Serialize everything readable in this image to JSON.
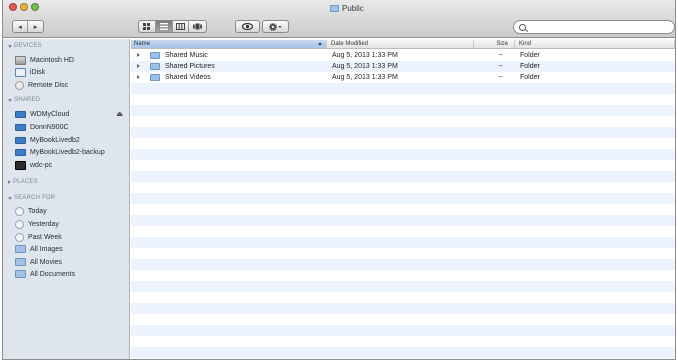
{
  "window": {
    "title": "Public"
  },
  "toolbar": {
    "back_label": "◂",
    "forward_label": "▸",
    "search_placeholder": ""
  },
  "sidebar": {
    "sections": [
      {
        "label": "DEVICES"
      },
      {
        "label": "SHARED"
      },
      {
        "label": "PLACES"
      },
      {
        "label": "SEARCH FOR"
      }
    ],
    "devices": [
      {
        "label": "Macintosh HD",
        "icon": "hard-drive-icon"
      },
      {
        "label": "iDisk",
        "icon": "idisk-icon"
      },
      {
        "label": "Remote Disc",
        "icon": "disc-icon"
      }
    ],
    "shared": [
      {
        "label": "WDMyCloud",
        "icon": "network-drive-icon"
      },
      {
        "label": "DonnN900C",
        "icon": "network-drive-icon"
      },
      {
        "label": "MyBookLivedb2",
        "icon": "network-drive-icon"
      },
      {
        "label": "MyBookLivedb2-backup",
        "icon": "network-drive-icon"
      },
      {
        "label": "wdc-pc",
        "icon": "pc-icon"
      }
    ],
    "search_for": [
      {
        "label": "Today",
        "icon": "clock-icon"
      },
      {
        "label": "Yesterday",
        "icon": "clock-icon"
      },
      {
        "label": "Past Week",
        "icon": "clock-icon"
      },
      {
        "label": "All Images",
        "icon": "smart-folder-icon"
      },
      {
        "label": "All Movies",
        "icon": "smart-folder-icon"
      },
      {
        "label": "All Documents",
        "icon": "smart-folder-icon"
      }
    ],
    "eject_symbol": "⏏"
  },
  "list": {
    "columns": {
      "name": "Name",
      "date": "Date Modified",
      "size": "Size",
      "kind": "Kind"
    },
    "rows": [
      {
        "name": "Shared Music",
        "date": "Aug 5, 2013 1:33 PM",
        "size": "--",
        "kind": "Folder"
      },
      {
        "name": "Shared Pictures",
        "date": "Aug 5, 2013 1:33 PM",
        "size": "--",
        "kind": "Folder"
      },
      {
        "name": "Shared Videos",
        "date": "Aug 5, 2013 1:33 PM",
        "size": "--",
        "kind": "Folder"
      }
    ]
  },
  "colors": {
    "sidebar_bg": "#dfe5ed",
    "row_stripe": "#edf3fe",
    "folder_blue": "#9dc0e6"
  }
}
